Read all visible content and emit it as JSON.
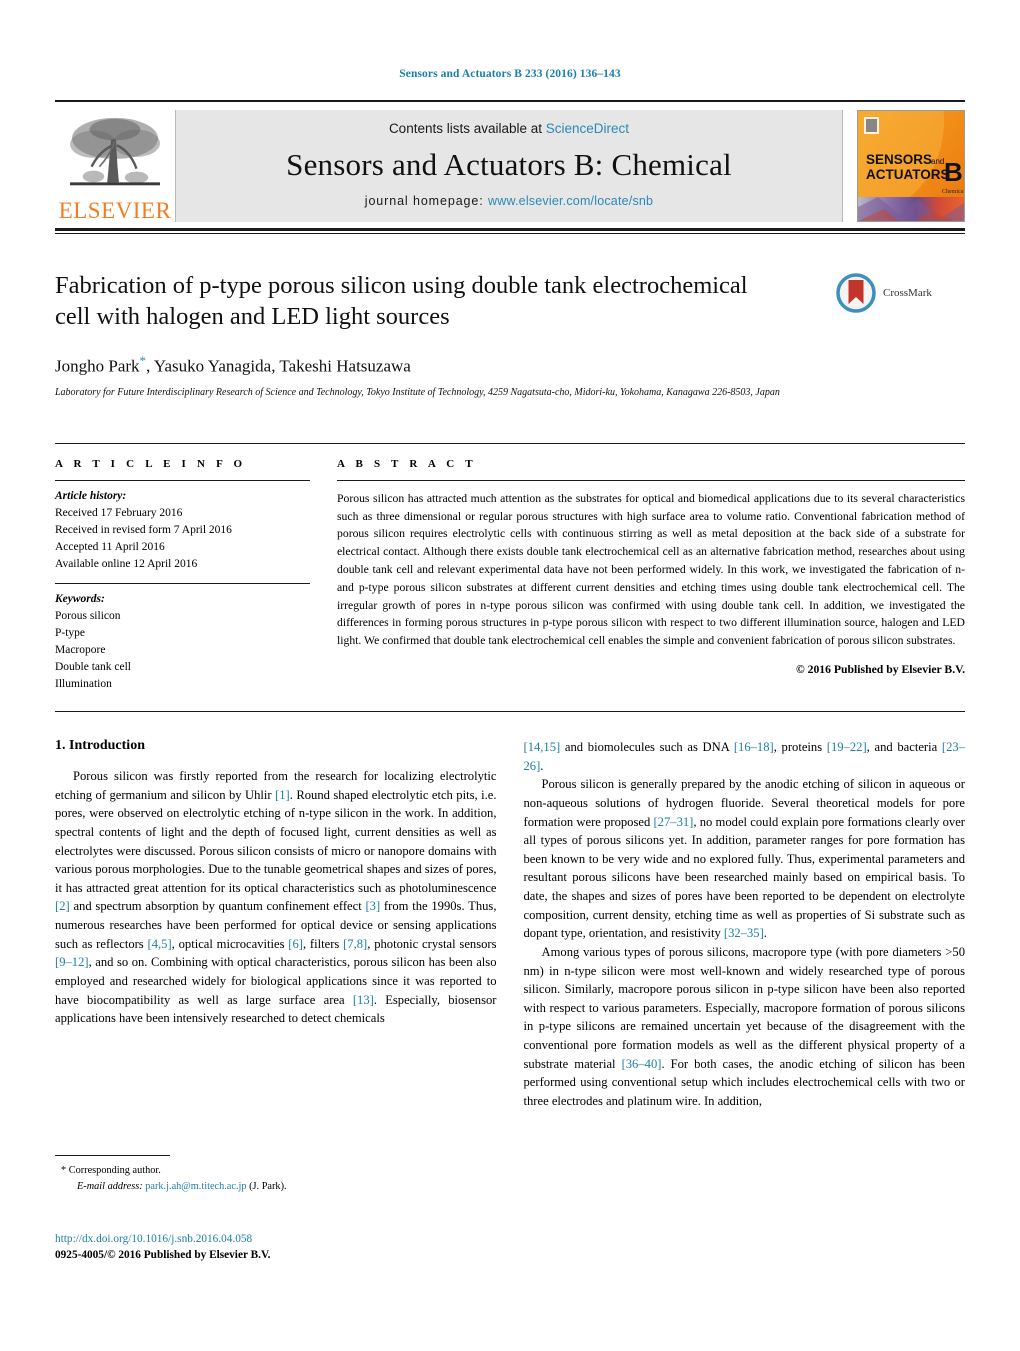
{
  "running_head": "Sensors and Actuators B 233 (2016) 136–143",
  "masthead": {
    "publisher": "ELSEVIER",
    "contents_prefix": "Contents lists available at ",
    "contents_link": "ScienceDirect",
    "journal_name": "Sensors and Actuators B: Chemical",
    "homepage_prefix": "journal homepage:",
    "homepage_url": "www.elsevier.com/locate/snb",
    "cover_title_line1": "SENSORS",
    "cover_title_and": "and",
    "cover_title_line2": "ACTUATORS",
    "cover_letter": "B",
    "cover_sub": "Chemical",
    "colors": {
      "link": "#2a89b8",
      "elsevier_orange": "#ef7d22",
      "band_gray": "#e6e6e6"
    }
  },
  "article": {
    "title": "Fabrication of p-type porous silicon using double tank electrochemical cell with halogen and LED light sources",
    "authors": "Jongho Park",
    "authors_rest": ", Yasuko Yanagida, Takeshi Hatsuzawa",
    "corresponding_marker": "*",
    "affiliation": "Laboratory for Future Interdisciplinary Research of Science and Technology, Tokyo Institute of Technology, 4259 Nagatsuta-cho, Midori-ku, Yokohama, Kanagawa 226-8503, Japan",
    "crossmark_label": "CrossMark"
  },
  "article_info": {
    "heading": "A R T I C L E   I N F O",
    "history_label": "Article history:",
    "history": [
      "Received 17 February 2016",
      "Received in revised form 7 April 2016",
      "Accepted 11 April 2016",
      "Available online 12 April 2016"
    ],
    "keywords_label": "Keywords:",
    "keywords": [
      "Porous silicon",
      "P-type",
      "Macropore",
      "Double tank cell",
      "Illumination"
    ]
  },
  "abstract": {
    "heading": "A B S T R A C T",
    "text": "Porous silicon has attracted much attention as the substrates for optical and biomedical applications due to its several characteristics such as three dimensional or regular porous structures with high surface area to volume ratio. Conventional fabrication method of porous silicon requires electrolytic cells with continuous stirring as well as metal deposition at the back side of a substrate for electrical contact. Although there exists double tank electrochemical cell as an alternative fabrication method, researches about using double tank cell and relevant experimental data have not been performed widely. In this work, we investigated the fabrication of n- and p-type porous silicon substrates at different current densities and etching times using double tank electrochemical cell. The irregular growth of pores in n-type porous silicon was confirmed with using double tank cell. In addition, we investigated the differences in forming porous structures in p-type porous silicon with respect to two different illumination source, halogen and LED light. We confirmed that double tank electrochemical cell enables the simple and convenient fabrication of porous silicon substrates.",
    "copyright": "© 2016 Published by Elsevier B.V."
  },
  "introduction": {
    "section_number": "1.",
    "section_title": "Introduction",
    "left_paragraph_1_parts": [
      "Porous silicon was firstly reported from the research for localizing electrolytic etching of germanium and silicon by Uhlir ",
      "[1]",
      ". Round shaped electrolytic etch pits, i.e. pores, were observed on electrolytic etching of n-type silicon in the work. In addition, spectral contents of light and the depth of focused light, current densities as well as electrolytes were discussed. Porous silicon consists of micro or nanopore domains with various porous morphologies. Due to the tunable geometrical shapes and sizes of pores, it has attracted great attention for its optical characteristics such as photoluminescence ",
      "[2]",
      " and spectrum absorption by quantum confinement effect ",
      "[3]",
      " from the 1990s. Thus, numerous researches have been performed for optical device or sensing applications such as reflectors ",
      "[4,5]",
      ", optical microcavities ",
      "[6]",
      ", filters ",
      "[7,8]",
      ", photonic crystal sensors ",
      "[9–12]",
      ", and so on. Combining with optical characteristics, porous silicon has been also employed and researched widely for biological applications since it was reported to have biocompatibility as well as large surface area ",
      "[13]",
      ". Especially, biosensor applications have been intensively researched to detect chemicals "
    ],
    "right_continuation_parts": [
      "[14,15]",
      " and biomolecules such as DNA ",
      "[16–18]",
      ", proteins ",
      "[19–22]",
      ", and bacteria ",
      "[23–26]",
      "."
    ],
    "right_paragraph_2_parts": [
      "Porous silicon is generally prepared by the anodic etching of silicon in aqueous or non-aqueous solutions of hydrogen fluoride. Several theoretical models for pore formation were proposed ",
      "[27–31]",
      ", no model could explain pore formations clearly over all types of porous silicons yet. In addition, parameter ranges for pore formation has been known to be very wide and no explored fully. Thus, experimental parameters and resultant porous silicons have been researched mainly based on empirical basis. To date, the shapes and sizes of pores have been reported to be dependent on electrolyte composition, current density, etching time as well as properties of Si substrate such as dopant type, orientation, and resistivity ",
      "[32–35]",
      "."
    ],
    "right_paragraph_3_parts": [
      "Among various types of porous silicons, macropore type (with pore diameters >50 nm) in n-type silicon were most well-known and widely researched type of porous silicon. Similarly, macropore porous silicon in p-type silicon have been also reported with respect to various parameters. Especially, macropore formation of porous silicons in p-type silicons are remained uncertain yet because of the disagreement with the conventional pore formation models as well as the different physical property of a substrate material ",
      "[36–40]",
      ". For both cases, the anodic etching of silicon has been performed using conventional setup which includes electrochemical cells with two or three electrodes and platinum wire. In addition,"
    ]
  },
  "footer": {
    "corresponding_marker": "*",
    "corresponding_text": "Corresponding author.",
    "email_label": "E-mail address:",
    "email": "park.j.ah@m.titech.ac.jp",
    "email_owner": "(J. Park).",
    "doi": "http://dx.doi.org/10.1016/j.snb.2016.04.058",
    "issn_line": "0925-4005/© 2016 Published by Elsevier B.V."
  }
}
